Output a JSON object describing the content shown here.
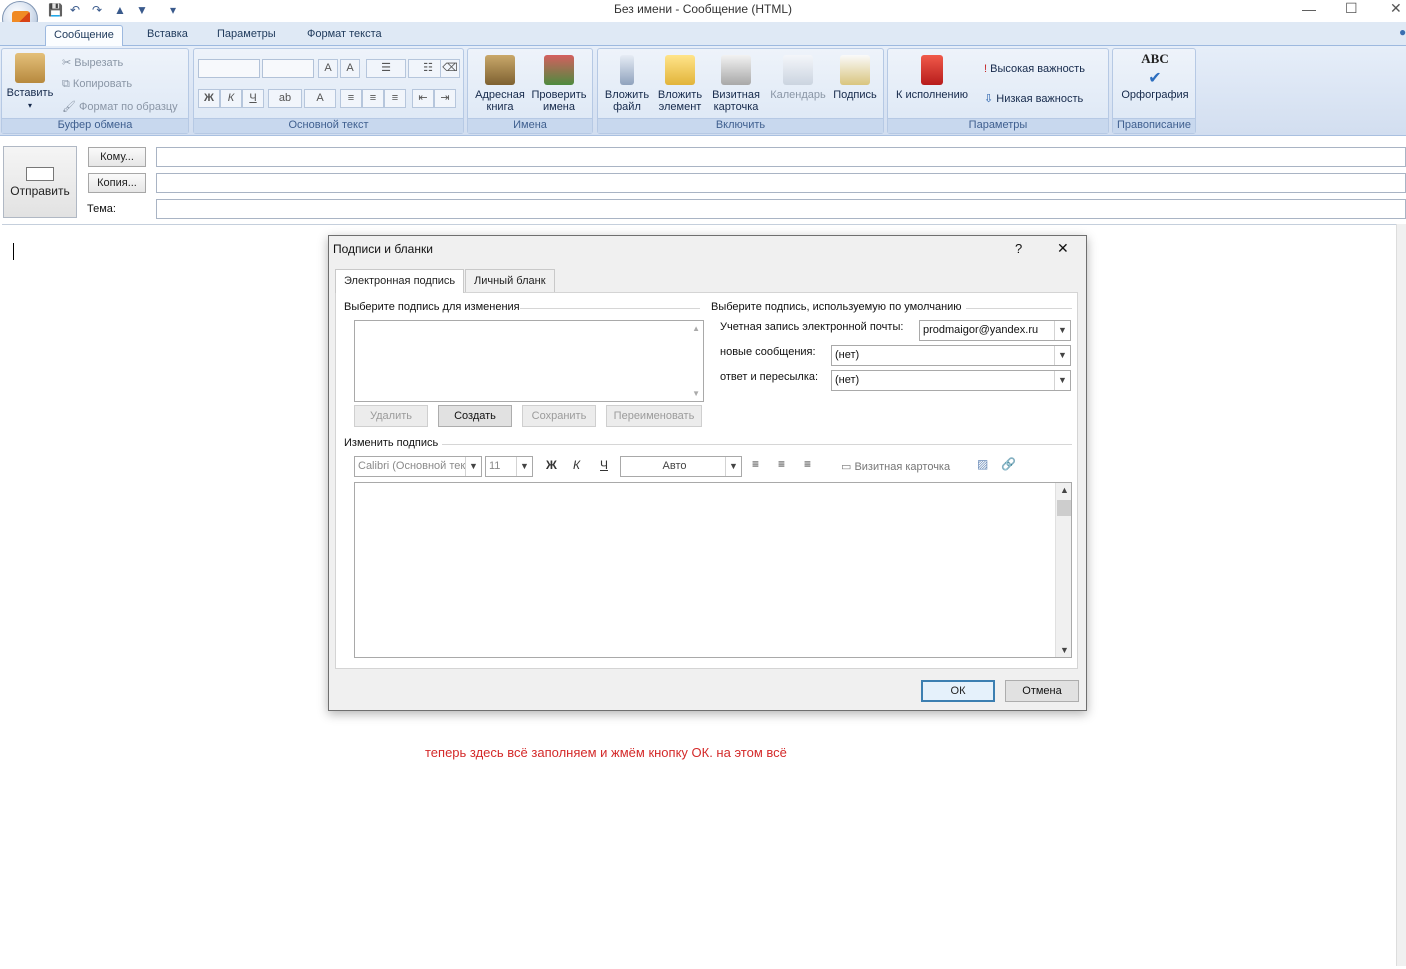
{
  "window": {
    "title": "Без имени - Сообщение (HTML)"
  },
  "quick_access": {
    "more": "▾"
  },
  "tabs": [
    "Сообщение",
    "Вставка",
    "Параметры",
    "Формат текста"
  ],
  "ribbon": {
    "clipboard": {
      "label": "Буфер обмена",
      "paste": "Вставить",
      "cut": "Вырезать",
      "copy": "Копировать",
      "format_painter": "Формат по образцу"
    },
    "basic_text": {
      "label": "Основной текст",
      "bold": "Ж",
      "italic": "К",
      "underline": "Ч"
    },
    "names": {
      "label": "Имена",
      "address_book": "Адресная книга",
      "check_names": "Проверить имена"
    },
    "include": {
      "label": "Включить",
      "attach_file": "Вложить файл",
      "attach_item": "Вложить элемент",
      "business_card": "Визитная карточка",
      "calendar": "Календарь",
      "signature": "Подпись"
    },
    "options": {
      "label": "Параметры",
      "follow_up": "К исполнению",
      "high_importance": "Высокая важность",
      "low_importance": "Низкая важность"
    },
    "proofing": {
      "label": "Правописание",
      "spelling": "Орфография",
      "abc": "ABC"
    }
  },
  "header": {
    "send": "Отправить",
    "to": "Кому...",
    "cc": "Копия...",
    "subject": "Тема:"
  },
  "note": "теперь здесь всё заполняем и жмём кнопку ОК. на этом всё",
  "dialog": {
    "title": "Подписи и бланки",
    "help": "?",
    "close": "✕",
    "tabs": [
      "Электронная подпись",
      "Личный бланк"
    ],
    "select_label": "Выберите подпись для изменения",
    "default_label": "Выберите подпись, используемую по умолчанию",
    "account_label": "Учетная запись электронной почты:",
    "account_value": "prodmaigor@yandex.ru",
    "new_msg_label": "новые сообщения:",
    "new_msg_value": "(нет)",
    "reply_label": "ответ и пересылка:",
    "reply_value": "(нет)",
    "buttons": {
      "delete": "Удалить",
      "create": "Создать",
      "save": "Сохранить",
      "rename": "Переименовать"
    },
    "edit_label": "Изменить подпись",
    "font": "Calibri (Основной текст)",
    "size": "11",
    "bold": "Ж",
    "italic": "К",
    "underline": "Ч",
    "color": "Авто",
    "business_card": "Визитная карточка",
    "ok": "ОК",
    "cancel": "Отмена"
  }
}
